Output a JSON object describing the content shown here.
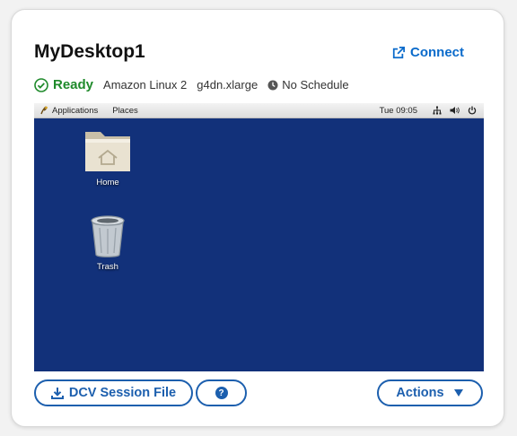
{
  "desktop": {
    "name": "MyDesktop1",
    "connect_label": "Connect",
    "status": "Ready",
    "os": "Amazon Linux 2",
    "instance_type": "g4dn.xlarge",
    "schedule": "No Schedule"
  },
  "preview": {
    "topbar": {
      "applications": "Applications",
      "places": "Places",
      "clock": "Tue 09:05"
    },
    "icons": [
      {
        "label": "Home"
      },
      {
        "label": "Trash"
      }
    ]
  },
  "buttons": {
    "session_file": "DCV Session File",
    "help": "?",
    "actions": "Actions"
  },
  "colors": {
    "accent": "#1c5fae",
    "link": "#0b6bcb",
    "ready": "#1f8a2b",
    "desktop_bg": "#12317a"
  }
}
